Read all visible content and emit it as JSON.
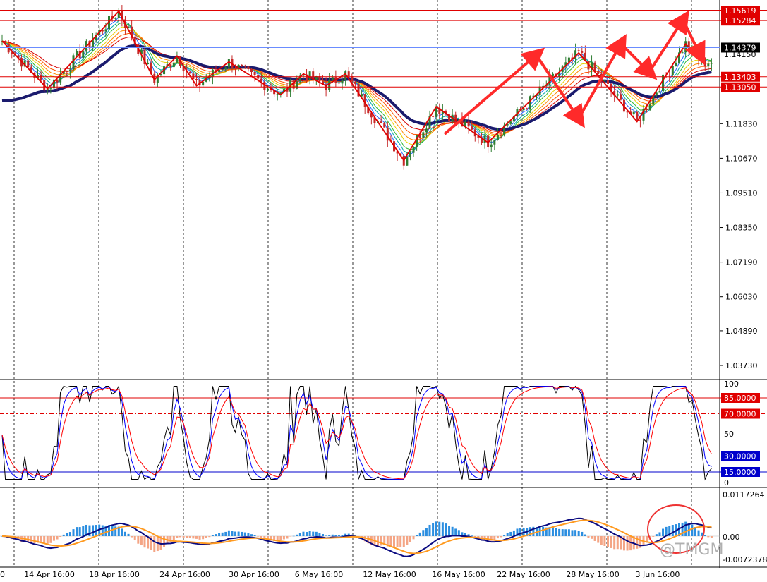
{
  "chart_data": [
    {
      "type": "candlestick",
      "panel": "price",
      "y_axis_labels": [
        "1.11830",
        "1.10670",
        "1.09510",
        "1.08350",
        "1.07190",
        "1.06030",
        "1.04890",
        "1.03730"
      ],
      "highlighted_levels": [
        {
          "label": "1.15619",
          "value": 1.15619,
          "color": "#e00000"
        },
        {
          "label": "1.15284",
          "value": 1.15284,
          "color": "#e00000"
        },
        {
          "label": "1.13403",
          "value": 1.13403,
          "color": "#e00000"
        },
        {
          "label": "1.13050",
          "value": 1.1305,
          "color": "#e00000"
        }
      ],
      "current_price": {
        "label": "1.14379",
        "value": 1.14379
      },
      "extra_label": "1.14150",
      "zigzag_points": [
        [
          0,
          1.146
        ],
        [
          14,
          1.13
        ],
        [
          36,
          1.156
        ],
        [
          47,
          1.133
        ],
        [
          54,
          1.141
        ],
        [
          60,
          1.131
        ],
        [
          70,
          1.139
        ],
        [
          86,
          1.128
        ],
        [
          93,
          1.135
        ],
        [
          100,
          1.131
        ],
        [
          106,
          1.135
        ],
        [
          124,
          1.106
        ],
        [
          134,
          1.124
        ],
        [
          150,
          1.112
        ],
        [
          178,
          1.142
        ],
        [
          196,
          1.119
        ],
        [
          211,
          1.145
        ],
        [
          216,
          1.139
        ]
      ],
      "ma_series_colors": [
        "#1b1b6e",
        "#d40000",
        "#ff8800",
        "#e8d000",
        "#33bb33",
        "#00aaaa",
        "#2266ff"
      ],
      "colors": {
        "bull": "#2e7d32",
        "bear": "#c62828",
        "grid": "#000000",
        "zigzag": "#e00000",
        "arrow": "#ff2a2a",
        "slow_ma": "#1b1b6e"
      }
    },
    {
      "type": "line",
      "panel": "stochastic",
      "y_axis_labels": [
        "100",
        "50",
        "0"
      ],
      "levels": [
        {
          "label": "85.0000",
          "value": 85,
          "color": "#e00000"
        },
        {
          "label": "70.0000",
          "value": 70,
          "color": "#e00000"
        },
        {
          "label": "30.0000",
          "value": 30,
          "color": "#0000cc"
        },
        {
          "label": "15.0000",
          "value": 15,
          "color": "#0000cc"
        }
      ],
      "ylim": [
        0,
        100
      ],
      "series_colors": [
        "#000000",
        "#0000ff",
        "#ff0000"
      ]
    },
    {
      "type": "histogram+line",
      "panel": "macd",
      "y_axis_labels": [
        "0.0117264",
        "0.00",
        "-0.0072378"
      ],
      "ylim": [
        -0.0072378,
        0.0117264
      ],
      "series_colors": [
        "#0a0a80",
        "#ff9a1f"
      ],
      "histogram_colors": {
        "positive": "#2b8ee0",
        "negative": "#f4a585"
      }
    }
  ],
  "x_axis_labels": [
    "14 Apr 16:00",
    "18 Apr 16:00",
    "24 Apr 16:00",
    "30 Apr 16:00",
    "6 May 16:00",
    "12 May 16:00",
    "16 May 16:00",
    "22 May 16:00",
    "28 May 16:00",
    "3 Jun 16:00"
  ],
  "x_axis_first_label": "0",
  "watermark": "@TMGM"
}
